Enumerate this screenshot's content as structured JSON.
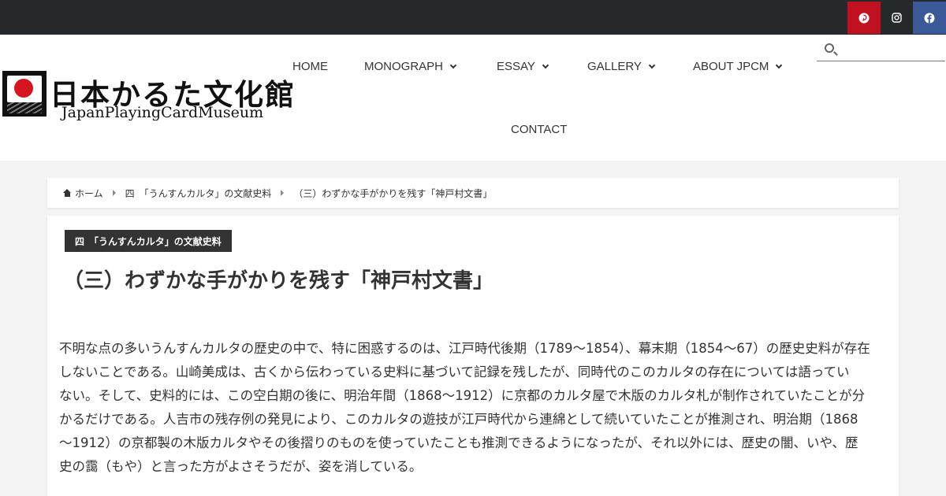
{
  "social": {
    "pinterest_icon": "pinterest-icon",
    "instagram_icon": "instagram-icon",
    "facebook_icon": "facebook-icon",
    "colors": {
      "pinterest": "#c1101e",
      "facebook": "#3b5998",
      "topbar": "#25292c"
    }
  },
  "logo": {
    "jp": "日本かるた文化館",
    "en": "JapanPlayingCardMuseum"
  },
  "nav": {
    "home": "HOME",
    "monograph": "MONOGRAPH",
    "essay": "ESSAY",
    "gallery": "GALLERY",
    "about": "ABOUT JPCM",
    "contact": "CONTACT"
  },
  "search": {
    "placeholder": ""
  },
  "breadcrumb": {
    "home": "ホーム",
    "category": "四　「うんすんカルタ」の文献史料",
    "current": "（三）わずかな手がかりを残す「神戸村文書」"
  },
  "article": {
    "category": "四　「うんすんカルタ」の文献史料",
    "title": "（三）わずかな手がかりを残す「神戸村文書」",
    "lines": [
      "不明な点の多いうんすんカルタの歴史の中で、特に困惑するのは、江戸時代後期（1789～1854）、幕末期（1854～67）の歴史史料が存在",
      "しないことである。山崎美成は、古くから伝わっている史料に基づいて記録を残したが、同時代のこのカルタの存在については語ってい",
      "ない。そして、史料的には、この空白期の後に、明治年間（1868～1912）に京都のカルタ屋で木版のカルタ札が制作されていたことが分",
      "かるだけである。人吉市の残存例の発見により、このカルタの遊技が江戸時代から連綿として続いていたことが推測され、明治期（1868",
      "～1912）の京都製の木版カルタやその後摺りのものを使っていたことも推測できるようになったが、それ以外には、歴史の闇、いや、歴",
      "史の靄（もや）と言った方がよさそうだが、姿を消している。"
    ]
  }
}
